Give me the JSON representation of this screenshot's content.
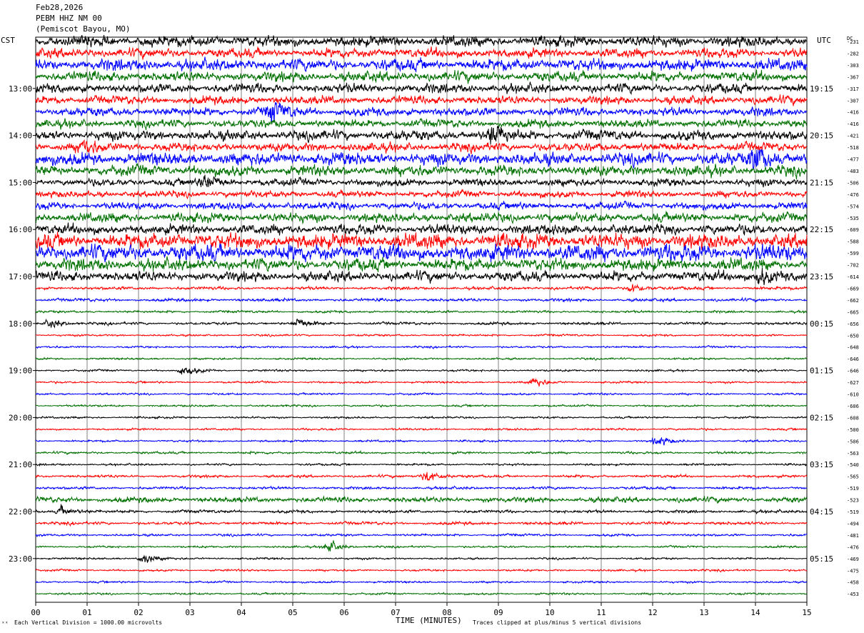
{
  "header": {
    "date": "Feb28,2026",
    "station": "PEBM HHZ NM 00",
    "location": "(Pemiscot Bayou, MO)"
  },
  "left_tz": "CST",
  "right_tz": "UTC",
  "dc_label": "DC",
  "footer": {
    "scale_note": "Each Vertical Division = 1000.00 microvolts",
    "clip_note": "Traces clipped at plus/minus 5 vertical divisions",
    "corner_mark": "ˣˣ"
  },
  "chart_data": {
    "type": "line",
    "title": "",
    "xlabel": "TIME (MINUTES)",
    "xlim": [
      0,
      15
    ],
    "x_ticks": [
      "00",
      "01",
      "02",
      "03",
      "04",
      "05",
      "06",
      "07",
      "08",
      "09",
      "10",
      "11",
      "12",
      "13",
      "14",
      "15"
    ],
    "trace_colors": [
      "#000000",
      "#ff0000",
      "#0000ff",
      "#007000"
    ],
    "left_hour_labels": [
      "13:00",
      "14:00",
      "15:00",
      "16:00",
      "17:00",
      "18:00",
      "19:00",
      "20:00",
      "21:00",
      "22:00",
      "23:00"
    ],
    "right_hour_labels": [
      "19:15",
      "20:15",
      "21:15",
      "22:15",
      "23:15",
      "00:15",
      "01:15",
      "02:15",
      "03:15",
      "04:15",
      "05:15"
    ],
    "dc_offsets": [
      "-231",
      "-282",
      "-303",
      "-367",
      "-317",
      "-307",
      "-416",
      "-416",
      "-421",
      "-518",
      "-477",
      "-483",
      "-506",
      "-476",
      "-574",
      "-535",
      "-609",
      "-588",
      "-599",
      "-702",
      "-614",
      "-669",
      "-662",
      "-665",
      "-656",
      "-650",
      "-648",
      "-646",
      "-646",
      "-627",
      "-610",
      "-606",
      "-608",
      "-500",
      "-506",
      "-563",
      "-540",
      "-565",
      "-519",
      "-523",
      "-519",
      "-494",
      "-481",
      "-476",
      "-469",
      "-475",
      "-458",
      "-453"
    ],
    "trace_noise_amplitude": [
      3.2,
      2.8,
      3.5,
      3.0,
      2.8,
      2.5,
      2.6,
      2.4,
      3.0,
      2.6,
      3.8,
      3.2,
      2.2,
      2.0,
      2.2,
      2.8,
      3.0,
      4.5,
      5.0,
      3.6,
      3.0,
      0.9,
      0.9,
      0.7,
      0.8,
      0.6,
      0.6,
      0.6,
      0.6,
      0.6,
      0.6,
      0.6,
      0.6,
      0.6,
      0.6,
      0.7,
      0.6,
      0.8,
      0.8,
      1.6,
      0.9,
      0.9,
      0.7,
      0.6,
      0.6,
      0.6,
      0.6,
      0.6
    ],
    "events": [
      {
        "trace": 8,
        "minute": 8.9,
        "amplitude": 9
      },
      {
        "trace": 9,
        "minute": 0.9,
        "amplitude": 6
      },
      {
        "trace": 10,
        "minute": 14.0,
        "amplitude": 14
      },
      {
        "trace": 6,
        "minute": 4.6,
        "amplitude": 9
      },
      {
        "trace": 12,
        "minute": 3.3,
        "amplitude": 7
      },
      {
        "trace": 20,
        "minute": 14.1,
        "amplitude": 7
      },
      {
        "trace": 24,
        "minute": 0.3,
        "amplitude": 4
      },
      {
        "trace": 24,
        "minute": 5.1,
        "amplitude": 4
      },
      {
        "trace": 28,
        "minute": 2.9,
        "amplitude": 4
      },
      {
        "trace": 29,
        "minute": 9.7,
        "amplitude": 4
      },
      {
        "trace": 34,
        "minute": 12.1,
        "amplitude": 4
      },
      {
        "trace": 37,
        "minute": 7.6,
        "amplitude": 5
      },
      {
        "trace": 40,
        "minute": 0.5,
        "amplitude": 4
      },
      {
        "trace": 43,
        "minute": 5.7,
        "amplitude": 5
      },
      {
        "trace": 44,
        "minute": 2.1,
        "amplitude": 4
      },
      {
        "trace": 21,
        "minute": 11.6,
        "amplitude": 4
      }
    ]
  }
}
